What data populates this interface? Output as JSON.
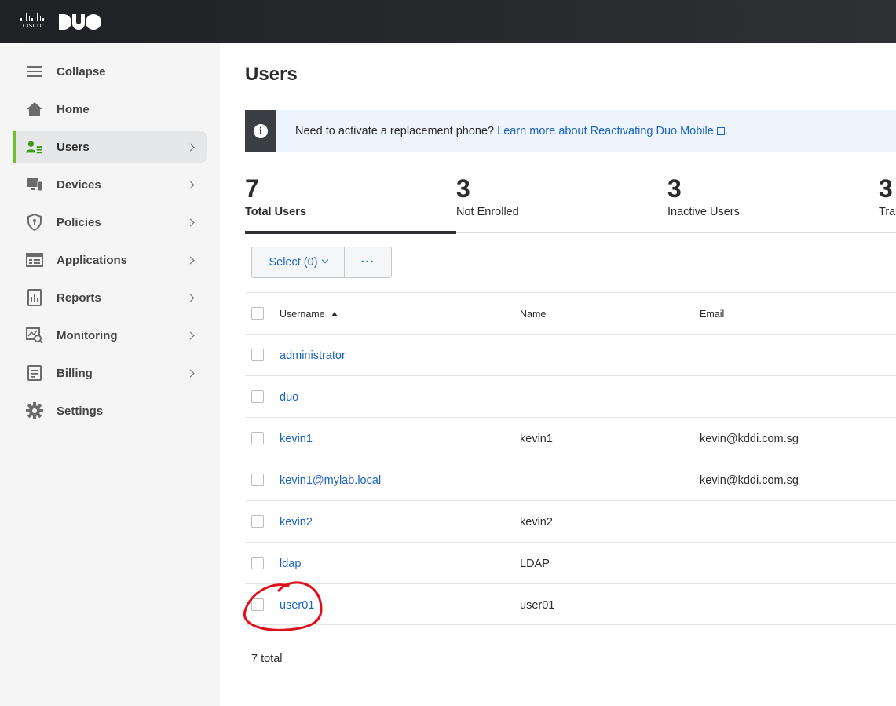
{
  "topbar": {
    "cisco_logo_text": "CISCO",
    "duo_logo_text": "DUO"
  },
  "sidebar": {
    "items": [
      {
        "label": "Collapse",
        "icon": "hamburger-icon",
        "chevron": false
      },
      {
        "label": "Home",
        "icon": "home-icon",
        "chevron": false
      },
      {
        "label": "Users",
        "icon": "users-icon",
        "chevron": true,
        "active": true
      },
      {
        "label": "Devices",
        "icon": "devices-icon",
        "chevron": true
      },
      {
        "label": "Policies",
        "icon": "shield-icon",
        "chevron": true
      },
      {
        "label": "Applications",
        "icon": "applications-icon",
        "chevron": true
      },
      {
        "label": "Reports",
        "icon": "reports-icon",
        "chevron": true
      },
      {
        "label": "Monitoring",
        "icon": "monitoring-icon",
        "chevron": true
      },
      {
        "label": "Billing",
        "icon": "billing-icon",
        "chevron": true
      },
      {
        "label": "Settings",
        "icon": "gear-icon",
        "chevron": false
      }
    ]
  },
  "main": {
    "title": "Users",
    "banner": {
      "text": "Need to activate a replacement phone?",
      "link_text": "Learn more about Reactivating Duo Mobile",
      "trailing": "."
    },
    "stats": [
      {
        "num": "7",
        "label": "Total Users"
      },
      {
        "num": "3",
        "label": "Not Enrolled"
      },
      {
        "num": "3",
        "label": "Inactive Users"
      },
      {
        "num": "3",
        "label": "Tra"
      }
    ],
    "toolbar": {
      "select_label": "Select (0)",
      "more_label": "···"
    },
    "table": {
      "headers": {
        "username": "Username",
        "name": "Name",
        "email": "Email"
      },
      "rows": [
        {
          "username": "administrator",
          "name": "",
          "email": ""
        },
        {
          "username": "duo",
          "name": "",
          "email": ""
        },
        {
          "username": "kevin1",
          "name": "kevin1",
          "email": "kevin@kddi.com.sg"
        },
        {
          "username": "kevin1@mylab.local",
          "name": "",
          "email": "kevin@kddi.com.sg"
        },
        {
          "username": "kevin2",
          "name": "kevin2",
          "email": ""
        },
        {
          "username": "ldap",
          "name": "LDAP",
          "email": ""
        },
        {
          "username": "user01",
          "name": "user01",
          "email": ""
        }
      ]
    },
    "total_text": "7 total"
  },
  "colors": {
    "accent_green": "#6bbf30",
    "link_blue": "#1c63c5",
    "annotation_red": "#e0101a"
  }
}
